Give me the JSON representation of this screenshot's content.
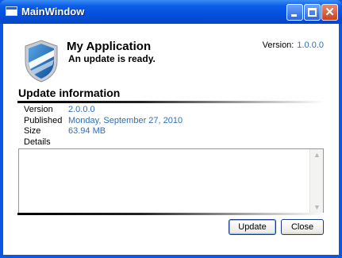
{
  "window": {
    "title": "MainWindow"
  },
  "header": {
    "app_name": "My Application",
    "status": "An update is ready.",
    "version_label": "Version:",
    "version_value": "1.0.0.0"
  },
  "update_info": {
    "title": "Update information",
    "rows": [
      {
        "label": "Version",
        "value": "2.0.0.0"
      },
      {
        "label": "Published",
        "value": "Monday, September 27, 2010"
      },
      {
        "label": "Size",
        "value": "63.94 MB"
      },
      {
        "label": "Details",
        "value": ""
      }
    ],
    "details_text": ""
  },
  "buttons": {
    "update": "Update",
    "close": "Close"
  },
  "colors": {
    "titlebar": "#0550dc",
    "link": "#2f6fb6",
    "shield": "#1f6fb8"
  },
  "icons": {
    "logo": "shield-icon"
  }
}
